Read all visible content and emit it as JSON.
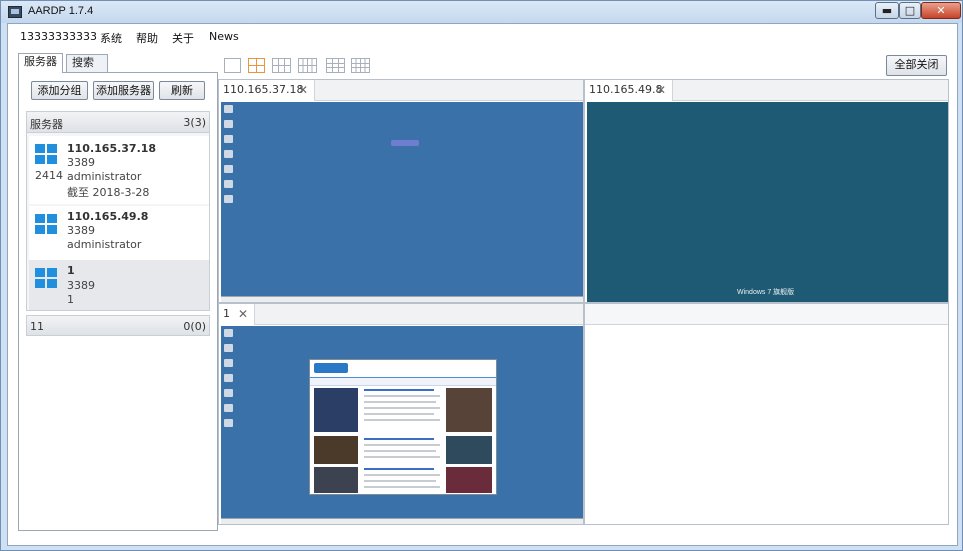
{
  "window": {
    "title": "AARDP 1.7.4",
    "controls": {
      "minimize": "▬",
      "maximize": "□",
      "close": "✕"
    }
  },
  "menu": [
    "13333333333",
    "系统",
    "帮助",
    "关于",
    "News"
  ],
  "left_tabs": [
    "服务器",
    "搜索"
  ],
  "left_buttons": {
    "add_group": "添加分组",
    "add_server": "添加服务器",
    "refresh": "刷新"
  },
  "server_group": {
    "name": "服务器",
    "count": "3(3)",
    "servers": [
      {
        "ip": "110.165.37.18",
        "port": "3389",
        "user": "administrator",
        "expire": "截至 2018-3-28",
        "num": "2414"
      },
      {
        "ip": "110.165.49.8",
        "port": "3389",
        "user": "administrator"
      },
      {
        "ip": "1",
        "port": "3389",
        "user": "1"
      }
    ]
  },
  "other_group": {
    "name": "11",
    "count": "0(0)"
  },
  "collapse_arrow": "‹",
  "toolbar": {
    "layout_icons": [
      "layout-1-icon",
      "layout-4-icon",
      "layout-6-icon",
      "layout-8-icon",
      "layout-9-icon",
      "layout-12-icon"
    ],
    "close_all": "全部关闭"
  },
  "panels": [
    {
      "title": "110.165.37.18",
      "close": "✕"
    },
    {
      "title": "110.165.49.8",
      "close": "✕",
      "os_label": "Windows 7 旗舰版"
    },
    {
      "title": "1",
      "close": "✕"
    }
  ],
  "colors": {
    "desktop_blue": "#3971a8",
    "win7_teal": "#1f5a75",
    "accent_orange": "#e7963f"
  }
}
